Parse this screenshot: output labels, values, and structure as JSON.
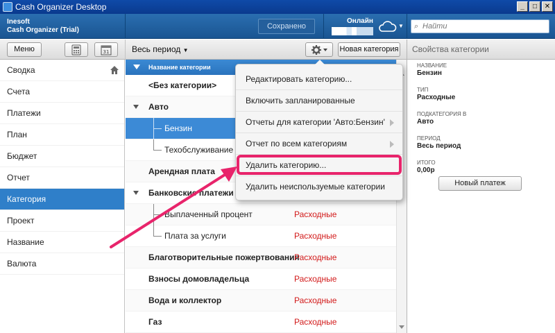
{
  "window": {
    "title": "Cash Organizer Desktop",
    "buttons": [
      "_",
      "□",
      "✕"
    ]
  },
  "header": {
    "company": "Inesoft",
    "product": "Cash Organizer (Trial)",
    "saved_label": "Сохранено",
    "online_label": "Онлайн",
    "search_placeholder": "Найти"
  },
  "toolbar": {
    "menu_label": "Меню",
    "period_label": "Весь период",
    "new_category_label": "Новая категория",
    "properties_title": "Свойства категории"
  },
  "sidebar": {
    "items": [
      {
        "label": "Сводка"
      },
      {
        "label": "Счета"
      },
      {
        "label": "Платежи"
      },
      {
        "label": "План"
      },
      {
        "label": "Бюджет"
      },
      {
        "label": "Отчет"
      },
      {
        "label": "Категория"
      },
      {
        "label": "Проект"
      },
      {
        "label": "Название"
      },
      {
        "label": "Валюта"
      }
    ],
    "active": "Категория"
  },
  "list": {
    "column_header": "Название категории",
    "rows": [
      {
        "name": "<Без категории>",
        "type": ""
      },
      {
        "name": "Авто",
        "type": ""
      },
      {
        "name": "Бензин",
        "type": ""
      },
      {
        "name": "Техобслуживание",
        "type": ""
      },
      {
        "name": "Арендная плата",
        "type": ""
      },
      {
        "name": "Банковские платежи",
        "type": ""
      },
      {
        "name": "Выплаченный процент",
        "type": "Расходные"
      },
      {
        "name": "Плата за услуги",
        "type": "Расходные"
      },
      {
        "name": "Благотворительные пожертвования",
        "type": "Расходные"
      },
      {
        "name": "Взносы домовладельца",
        "type": "Расходные"
      },
      {
        "name": "Вода и коллектор",
        "type": "Расходные"
      },
      {
        "name": "Газ",
        "type": "Расходные"
      }
    ]
  },
  "properties": {
    "name_label": "НАЗВАНИЕ",
    "name_value": "Бензин",
    "type_label": "ТИП",
    "type_value": "Расходные",
    "subcat_label": "ПОДКАТЕГОРИЯ В",
    "subcat_value": "Авто",
    "period_label": "ПЕРИОД",
    "period_value": "Весь период",
    "total_label": "ИТОГО",
    "total_value": "0,00р",
    "new_payment_label": "Новый платеж"
  },
  "context_menu": {
    "items": [
      {
        "label": "Редактировать категорию..."
      },
      {
        "label": "Включить запланированные"
      },
      {
        "label": "Отчеты для категории 'Авто:Бензин'"
      },
      {
        "label": "Отчет по всем категориям"
      },
      {
        "label": "Удалить категорию..."
      },
      {
        "label": "Удалить неиспользуемые категории"
      }
    ]
  },
  "colors": {
    "accent": "#2f7fc9",
    "expense_red": "#d21919",
    "callout_pink": "#e8246b"
  }
}
